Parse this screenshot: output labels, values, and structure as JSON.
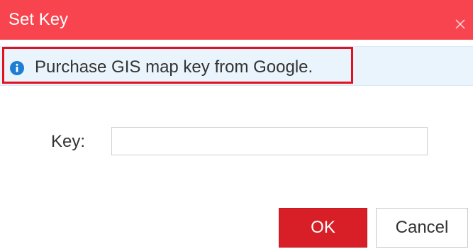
{
  "dialog": {
    "title": "Set Key",
    "info_message": "Purchase GIS map key from Google.",
    "key_label": "Key:",
    "key_value": "",
    "ok_label": "OK",
    "cancel_label": "Cancel",
    "close_icon": "close-icon",
    "info_icon": "info-circle-icon",
    "colors": {
      "titlebar": "#f7444e",
      "info_background": "#eaf4fc",
      "info_icon": "#1e7ed4",
      "highlight_border": "#e3111f",
      "ok_button": "#d81f27"
    }
  }
}
